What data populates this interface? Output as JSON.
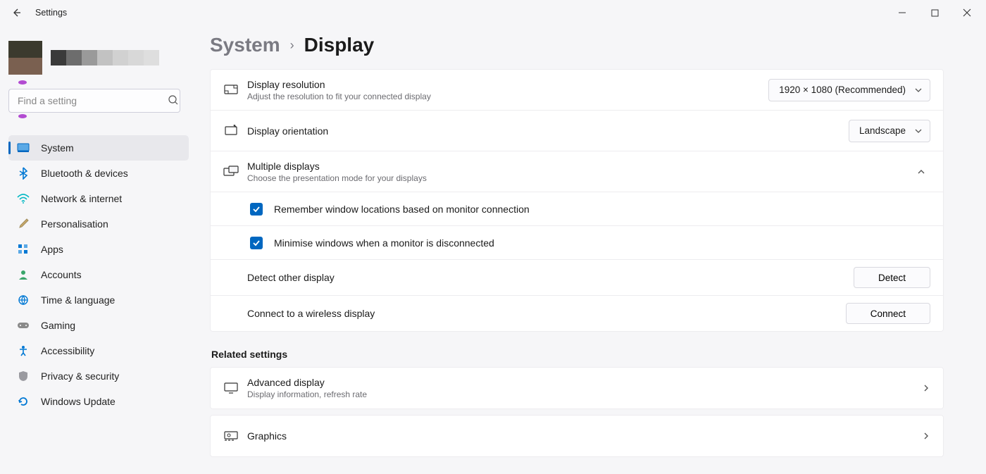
{
  "titlebar": {
    "title": "Settings"
  },
  "search": {
    "placeholder": "Find a setting"
  },
  "nav": {
    "items": [
      {
        "name": "system",
        "label": "System",
        "icon": "system-icon"
      },
      {
        "name": "bluetooth",
        "label": "Bluetooth & devices",
        "icon": "bluetooth-icon"
      },
      {
        "name": "network",
        "label": "Network & internet",
        "icon": "wifi-icon"
      },
      {
        "name": "personalisation",
        "label": "Personalisation",
        "icon": "brush-icon"
      },
      {
        "name": "apps",
        "label": "Apps",
        "icon": "apps-icon"
      },
      {
        "name": "accounts",
        "label": "Accounts",
        "icon": "person-icon"
      },
      {
        "name": "time",
        "label": "Time & language",
        "icon": "globe-icon"
      },
      {
        "name": "gaming",
        "label": "Gaming",
        "icon": "gamepad-icon"
      },
      {
        "name": "accessibility",
        "label": "Accessibility",
        "icon": "accessibility-icon"
      },
      {
        "name": "privacy",
        "label": "Privacy & security",
        "icon": "shield-icon"
      },
      {
        "name": "update",
        "label": "Windows Update",
        "icon": "update-icon"
      }
    ]
  },
  "breadcrumb": {
    "parent": "System",
    "current": "Display"
  },
  "rows": {
    "resolution": {
      "title": "Display resolution",
      "sub": "Adjust the resolution to fit your connected display",
      "value": "1920 × 1080 (Recommended)"
    },
    "orientation": {
      "title": "Display orientation",
      "value": "Landscape"
    },
    "multiple": {
      "title": "Multiple displays",
      "sub": "Choose the presentation mode for your displays",
      "opt1": "Remember window locations based on monitor connection",
      "opt2": "Minimise windows when a monitor is disconnected",
      "detect_label": "Detect other display",
      "detect_btn": "Detect",
      "wireless_label": "Connect to a wireless display",
      "connect_btn": "Connect"
    }
  },
  "related": {
    "heading": "Related settings",
    "advanced": {
      "title": "Advanced display",
      "sub": "Display information, refresh rate"
    },
    "graphics": {
      "title": "Graphics"
    }
  },
  "icons_colors": {
    "system": "#0078d4",
    "bluetooth": "#0078d4",
    "network": "#00b7c3",
    "brush": "#9e8b5c",
    "apps": "#0078d4",
    "person": "#39a56a",
    "globe": "#0078d4",
    "gamepad": "#7a7a7a",
    "access": "#0078d4",
    "shield": "#7a7a7a",
    "update": "#0078d4"
  }
}
